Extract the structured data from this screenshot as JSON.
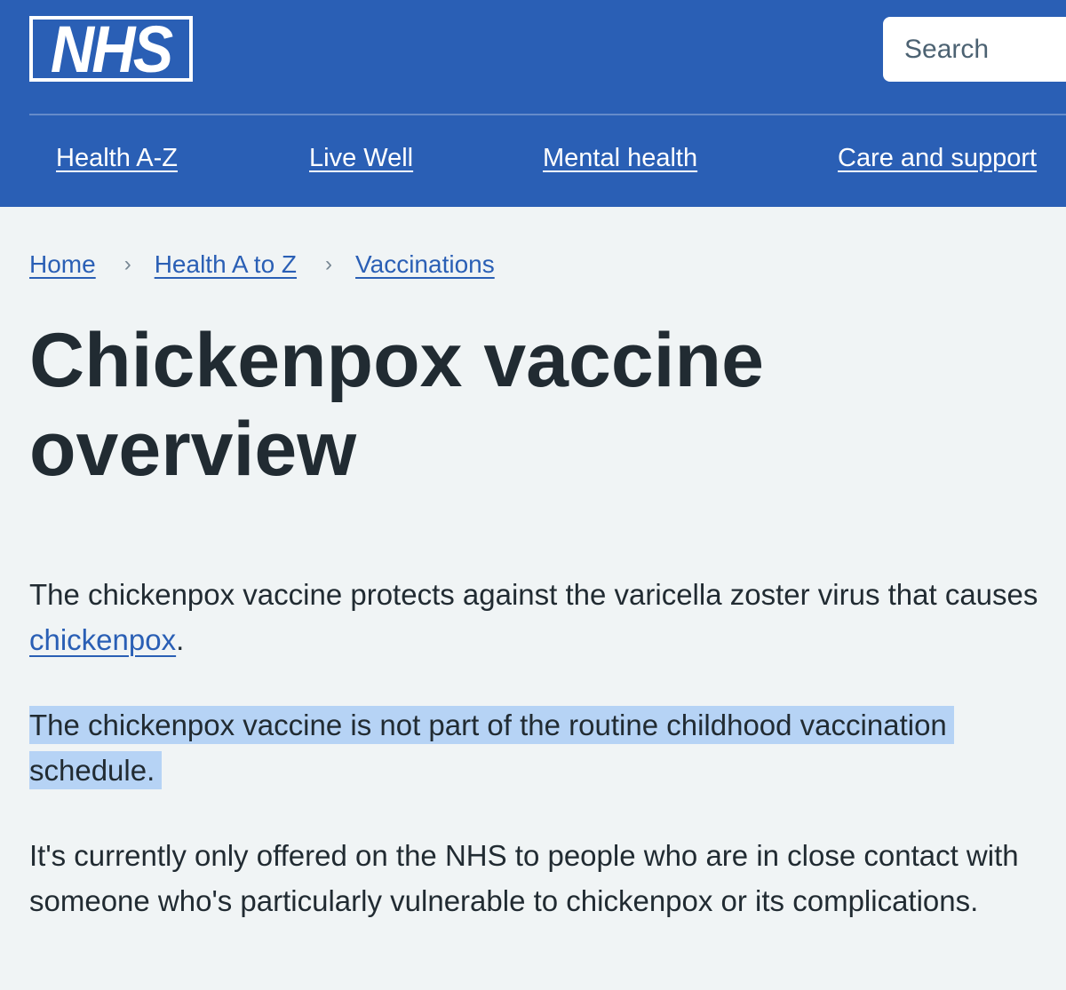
{
  "header": {
    "logo_text": "NHS",
    "search_placeholder": "Search",
    "colors": {
      "header_bg": "#2a5fb5",
      "page_bg": "#f0f4f5",
      "text": "#212b32",
      "link": "#2a5fb5",
      "selection_highlight": "#b6d3f5"
    }
  },
  "nav": {
    "items": [
      {
        "label": "Health A-Z"
      },
      {
        "label": "Live Well"
      },
      {
        "label": "Mental health"
      },
      {
        "label": "Care and support"
      }
    ]
  },
  "breadcrumb": {
    "items": [
      {
        "label": "Home"
      },
      {
        "label": "Health A to Z"
      },
      {
        "label": "Vaccinations"
      }
    ],
    "separator": "›"
  },
  "page": {
    "title": "Chickenpox vaccine overview",
    "paragraph1": {
      "text_before": "The chickenpox vaccine protects against the varicella zoster virus that causes ",
      "link": "chickenpox",
      "text_after": "."
    },
    "paragraph2": "The chickenpox vaccine is not part of the routine childhood vaccination schedule.",
    "paragraph3": "It's currently only offered on the NHS to people who are in close contact with someone who's particularly vulnerable to chickenpox or its complications."
  }
}
